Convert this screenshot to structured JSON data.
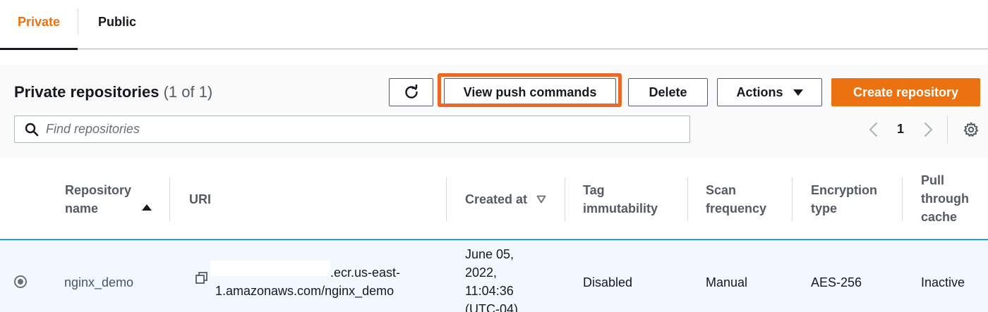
{
  "tabs": [
    {
      "label": "Private",
      "active": true
    },
    {
      "label": "Public",
      "active": false
    }
  ],
  "header": {
    "title": "Private repositories",
    "count": "(1 of 1)"
  },
  "toolbar": {
    "refresh_icon": "refresh-icon",
    "push_label": "View push commands",
    "delete_label": "Delete",
    "actions_label": "Actions",
    "create_label": "Create repository"
  },
  "search": {
    "placeholder": "Find repositories",
    "value": ""
  },
  "pagination": {
    "current_page": "1"
  },
  "table": {
    "columns": [
      {
        "line1": "Repository",
        "line2": "name",
        "line3": ""
      },
      {
        "line1": "URI",
        "line2": "",
        "line3": ""
      },
      {
        "line1": "Created at",
        "line2": "",
        "line3": ""
      },
      {
        "line1": "Tag",
        "line2": "immutability",
        "line3": ""
      },
      {
        "line1": "Scan",
        "line2": "frequency",
        "line3": ""
      },
      {
        "line1": "Encryption",
        "line2": "type",
        "line3": ""
      },
      {
        "line1": "Pull",
        "line2": "through",
        "line3": "cache"
      }
    ],
    "rows": [
      {
        "selected": true,
        "name": "nginx_demo",
        "uri_line1": ".ecr.us-east-",
        "uri_line2": "1.amazonaws.com/nginx_demo",
        "created_line1": "June 05,",
        "created_line2": "2022,",
        "created_line3": "11:04:36",
        "created_line4": "(UTC-04)",
        "tag_immutability": "Disabled",
        "scan_frequency": "Manual",
        "encryption_type": "AES-256",
        "pull_through_cache": "Inactive"
      }
    ]
  },
  "colors": {
    "accent": "#ec7211",
    "highlight": "#e8692a",
    "text": "#16191f",
    "muted": "#545b64"
  }
}
